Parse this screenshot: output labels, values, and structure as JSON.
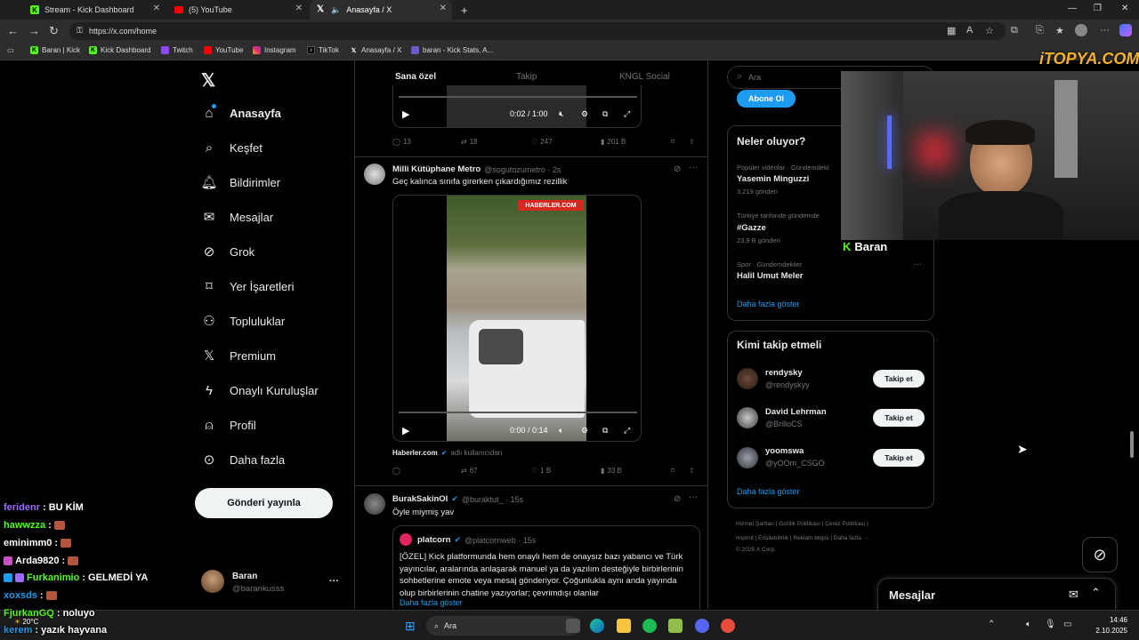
{
  "browser": {
    "tabs": [
      {
        "title": "Stream - Kick Dashboard",
        "icon": "kick-icon",
        "active": false
      },
      {
        "title": "(5) YouTube",
        "icon": "youtube-icon",
        "active": false
      },
      {
        "title": "Anasayfa / X",
        "icon": "x-icon",
        "active": true
      }
    ],
    "new_tab": "+",
    "window_controls": {
      "minimize": "—",
      "maximize": "❐",
      "close": "✕"
    },
    "url": "https://x.com/home",
    "bookmarks": [
      {
        "label": "Baran | Kick",
        "icon": "kick-icon"
      },
      {
        "label": "Kick Dashboard",
        "icon": "kick-icon"
      },
      {
        "label": "Twitch",
        "icon": "twitch-icon"
      },
      {
        "label": "YouTube",
        "icon": "youtube-icon"
      },
      {
        "label": "Instagram",
        "icon": "instagram-icon"
      },
      {
        "label": "TikTok",
        "icon": "tiktok-icon"
      },
      {
        "label": "Anasayfa / X",
        "icon": "x-icon"
      },
      {
        "label": "baran - Kick Stats, A...",
        "icon": "stats-icon"
      }
    ]
  },
  "nav": {
    "items": [
      {
        "label": "Anasayfa",
        "icon": "home-icon",
        "active": true
      },
      {
        "label": "Keşfet",
        "icon": "search-icon"
      },
      {
        "label": "Bildirimler",
        "icon": "bell-icon"
      },
      {
        "label": "Mesajlar",
        "icon": "mail-icon"
      },
      {
        "label": "Grok",
        "icon": "grok-icon"
      },
      {
        "label": "Yer İşaretleri",
        "icon": "bookmark-icon"
      },
      {
        "label": "Topluluklar",
        "icon": "communities-icon"
      },
      {
        "label": "Premium",
        "icon": "x-premium-icon"
      },
      {
        "label": "Onaylı Kuruluşlar",
        "icon": "lightning-icon"
      },
      {
        "label": "Profil",
        "icon": "person-icon"
      },
      {
        "label": "Daha fazla",
        "icon": "more-circle-icon"
      }
    ],
    "post_button": "Gönderi yayınla",
    "account": {
      "name": "Baran",
      "handle": "@barankusss",
      "more": "···"
    }
  },
  "feed": {
    "tabs": [
      "Sana özel",
      "Takip",
      "KNGL Social"
    ],
    "post0": {
      "video_time": "0:02 / 1:00",
      "replies": "13",
      "reposts": "18",
      "likes": "247",
      "views": "201 B"
    },
    "post1": {
      "name": "Milli Kütüphane Metro",
      "handle": "@sogutozumetro · 2s",
      "text": "Geç kalınca sınıfa girerken çıkardığımız rezillik",
      "watermark": "HABERLER.COM",
      "video_time": "0:00 / 0:14",
      "source": "Haberler.com",
      "source_suffix": "adlı kullanıcıdan",
      "replies": "",
      "reposts": "67",
      "likes": "1 B",
      "views": "33 B"
    },
    "post2": {
      "name": "BurakSakinOl",
      "handle": "@buraktut_ · 15s",
      "text": "Öyle miymiş yav",
      "quote_name": "platcorn",
      "quote_handle": "@platcornweb · 15s",
      "quote_text": "[ÖZEL] Kick platformunda hem onaylı hem de onaysız bazı yabancı ve Türk yayıncılar, aralarında anlaşarak manuel ya da yazılım desteğiyle birbirlerinin sohbetlerine emote veya mesaj gönderiyor. Çoğunlukla aynı anda yayında olup birbirlerinin chatine yazıyorlar; çevrimdışı olanlar",
      "show_more": "Daha fazla göster"
    }
  },
  "sidebar": {
    "search_placeholder": "Ara",
    "subscribe_button": "Abone Ol",
    "trends": {
      "title": "Neler oluyor?",
      "items": [
        {
          "context": "Popüler videolar · Gündemdeki",
          "name": "Yasemin Minguzzi",
          "count": "3,219 gönderi"
        },
        {
          "context": "Türkiye tarihinde gündemde",
          "name": "#Gazze",
          "count": "23,9 B gönderi"
        },
        {
          "context": "Spor · Gündemdekiler",
          "name": "Halil Umut Meler",
          "count": ""
        }
      ],
      "show_more": "Daha fazla göster"
    },
    "who_to_follow": {
      "title": "Kimi takip etmeli",
      "items": [
        {
          "name": "rendysky",
          "handle": "@rendyskyy"
        },
        {
          "name": "David Lehrman",
          "handle": "@BrilloCS"
        },
        {
          "name": "yoomswa",
          "handle": "@yOOm_CSGO"
        }
      ],
      "follow_label": "Takip et",
      "show_more": "Daha fazla göster"
    },
    "footer": {
      "line1": "Hizmet Şartları  |  Gizlilik Politikası  |  Çerez Politikası  |",
      "line2": "Imprint  |  Erişilebilirlik  |  Reklam bilgisi  |  Daha fazla ···",
      "line3": "© 2025 X Corp."
    }
  },
  "messages_bar": {
    "title": "Mesajlar"
  },
  "webcam": {
    "streamer_name": "Baran",
    "watermark": "iTOPYA.COM"
  },
  "chat": [
    {
      "user": "feridenr",
      "message": ": BU KİM",
      "color": "#9b6bff",
      "emote": false
    },
    {
      "user": "hawwzza",
      "message": ":",
      "color": "#53fc18",
      "emote": true
    },
    {
      "user": "eminimm0",
      "message": ":",
      "color": "#ffffff",
      "emote": true
    },
    {
      "user": "Arda9820",
      "message": ":",
      "color": "#ffffff",
      "emote": true
    },
    {
      "user": "Furkanimio",
      "message": ": GELMEDİ YA",
      "color": "#53fc18",
      "emote": false
    },
    {
      "user": "xoxsds",
      "message": ":",
      "color": "#1d9bf0",
      "emote": true
    },
    {
      "user": "FjurkanGQ",
      "message": ": noluyo",
      "color": "#53fc18",
      "emote": false
    },
    {
      "user": "kerem",
      "message": ": yazık hayvana",
      "color": "#1d9bf0",
      "emote": false
    }
  ],
  "taskbar": {
    "weather": "20°C",
    "search": "Ara",
    "time": "14:46",
    "date": "2.10.2025"
  },
  "colors": {
    "accent": "#1d9bf0",
    "kick_green": "#53fc18",
    "bg": "#000000",
    "border": "#2f3336"
  }
}
